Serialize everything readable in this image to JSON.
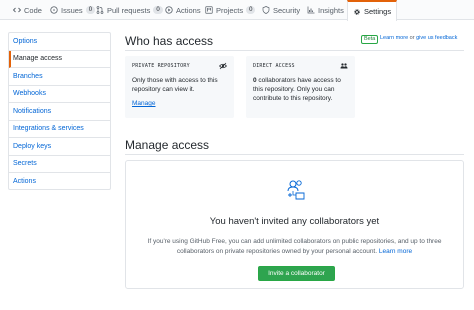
{
  "tabs": [
    {
      "label": "Code",
      "icon": "code-icon",
      "count": null
    },
    {
      "label": "Issues",
      "icon": "issue-icon",
      "count": "0"
    },
    {
      "label": "Pull requests",
      "icon": "pull-request-icon",
      "count": "0"
    },
    {
      "label": "Actions",
      "icon": "play-icon",
      "count": null
    },
    {
      "label": "Projects",
      "icon": "project-icon",
      "count": "0"
    },
    {
      "label": "Security",
      "icon": "shield-icon",
      "count": null
    },
    {
      "label": "Insights",
      "icon": "graph-icon",
      "count": null
    },
    {
      "label": "Settings",
      "icon": "gear-icon",
      "count": null,
      "selected": true
    }
  ],
  "sidebar": {
    "items": [
      {
        "label": "Options"
      },
      {
        "label": "Manage access",
        "active": true
      },
      {
        "label": "Branches"
      },
      {
        "label": "Webhooks"
      },
      {
        "label": "Notifications"
      },
      {
        "label": "Integrations & services"
      },
      {
        "label": "Deploy keys"
      },
      {
        "label": "Secrets"
      },
      {
        "label": "Actions"
      }
    ]
  },
  "who_has_access": {
    "title": "Who has access",
    "beta_label": "Beta",
    "feedback_prefix": "Learn more",
    "feedback_or": " or ",
    "feedback_link": "give us feedback",
    "private_card": {
      "caption": "PRIVATE REPOSITORY",
      "icon": "eye-icon",
      "text": "Only those with access to this repository can view it.",
      "link": "Manage"
    },
    "direct_card": {
      "caption": "DIRECT ACCESS",
      "icon": "people-icon",
      "count": "0",
      "text": " collaborators have access to this repository. Only you can contribute to this repository."
    }
  },
  "manage_access": {
    "title": "Manage access",
    "empty_icon": "collaborators-icon",
    "empty_title": "You haven't invited any collaborators yet",
    "empty_desc": "If you're using GitHub Free, you can add unlimited collaborators on public repositories, and up to three collaborators on private repositories owned by your personal account. ",
    "learn_more": "Learn more",
    "invite_button": "Invite a collaborator"
  },
  "colors": {
    "accent_orange": "#e36209",
    "link_blue": "#0366d6",
    "button_green": "#2ea44f",
    "border": "#e1e4e8"
  }
}
